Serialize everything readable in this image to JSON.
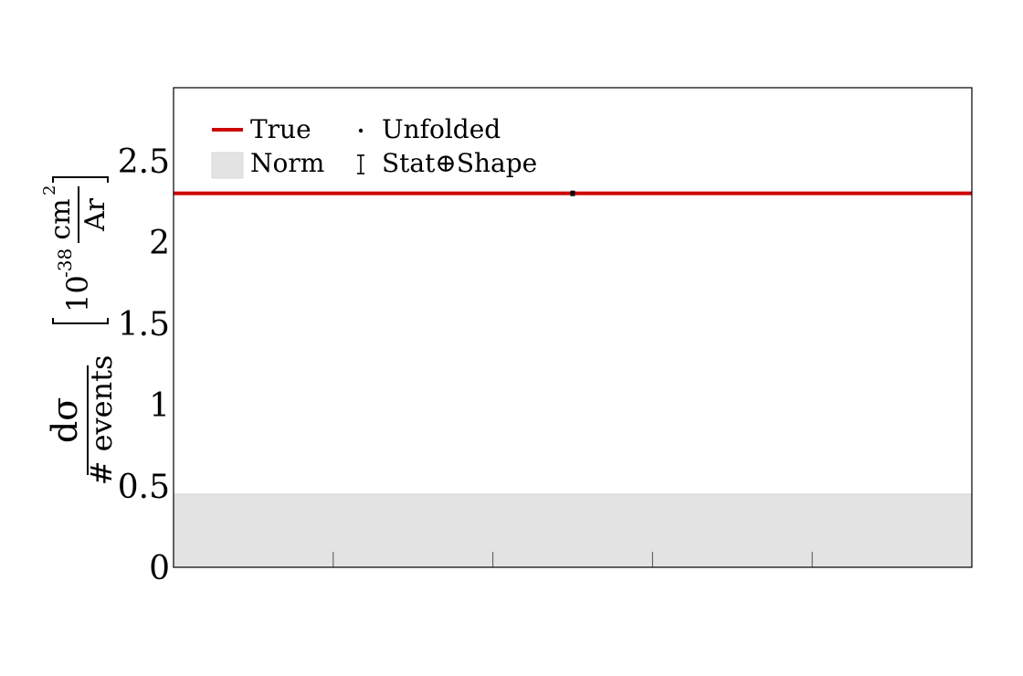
{
  "chart_data": {
    "type": "line",
    "ylim": [
      0,
      2.95
    ],
    "yticks": [
      {
        "value": 0,
        "label": "0"
      },
      {
        "value": 0.5,
        "label": "0.5"
      },
      {
        "value": 1,
        "label": "1"
      },
      {
        "value": 1.5,
        "label": "1.5"
      },
      {
        "value": 2,
        "label": "2"
      },
      {
        "value": 2.5,
        "label": "2.5"
      }
    ],
    "x_minor_ticks": 5,
    "ylabel": {
      "numerator": "dσ",
      "denominator": "# events",
      "unit_prefix": "10",
      "unit_exponent": "-38",
      "unit_numerator": "cm",
      "unit_num_exponent": "2",
      "unit_denominator": "Ar"
    },
    "series": [
      {
        "name": "True",
        "kind": "line",
        "y": 2.3,
        "color": "#cc0000"
      },
      {
        "name": "Unfolded",
        "kind": "point",
        "x": 0.5,
        "y": 2.3,
        "err": 0.015,
        "color": "#000000"
      },
      {
        "name": "Norm",
        "kind": "band",
        "y": [
          0,
          0.45
        ],
        "color": "#e3e3e3"
      }
    ],
    "legend": {
      "placement": "top-left",
      "entries": [
        {
          "key": "true",
          "label": "True"
        },
        {
          "key": "unfolded",
          "label": "Unfolded"
        },
        {
          "key": "norm",
          "label": "Norm"
        },
        {
          "key": "statshape",
          "label": "Stat⊕Shape"
        }
      ]
    }
  }
}
